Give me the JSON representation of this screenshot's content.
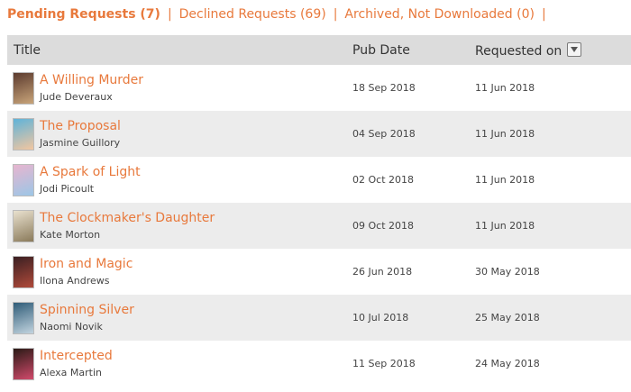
{
  "tabs": {
    "pending": "Pending Requests (7)",
    "declined": "Declined Requests (69)",
    "archived": "Archived, Not Downloaded (0)",
    "separator": "|"
  },
  "table": {
    "headers": {
      "title": "Title",
      "pub_date": "Pub Date",
      "requested_on": "Requested on"
    },
    "rows": [
      {
        "title": "A Willing Murder",
        "author": "Jude Deveraux",
        "pub_date": "18 Sep 2018",
        "requested_on": "11 Jun 2018",
        "cover_colors": [
          "#5b3a2e",
          "#c9a57a"
        ]
      },
      {
        "title": "The Proposal",
        "author": "Jasmine Guillory",
        "pub_date": "04 Sep 2018",
        "requested_on": "11 Jun 2018",
        "cover_colors": [
          "#5fb3d9",
          "#f2c6a0"
        ]
      },
      {
        "title": "A Spark of Light",
        "author": "Jodi Picoult",
        "pub_date": "02 Oct 2018",
        "requested_on": "11 Jun 2018",
        "cover_colors": [
          "#e7b5cf",
          "#9cc6e6"
        ]
      },
      {
        "title": "The Clockmaker's Daughter",
        "author": "Kate Morton",
        "pub_date": "09 Oct 2018",
        "requested_on": "11 Jun 2018",
        "cover_colors": [
          "#e9e1cf",
          "#8a7a5a"
        ]
      },
      {
        "title": "Iron and Magic",
        "author": "Ilona Andrews",
        "pub_date": "26 Jun 2018",
        "requested_on": "30 May 2018",
        "cover_colors": [
          "#3a1f22",
          "#b04a3a"
        ]
      },
      {
        "title": "Spinning Silver",
        "author": "Naomi Novik",
        "pub_date": "10 Jul 2018",
        "requested_on": "25 May 2018",
        "cover_colors": [
          "#2f5c78",
          "#c2d4df"
        ]
      },
      {
        "title": "Intercepted",
        "author": "Alexa Martin",
        "pub_date": "11 Sep 2018",
        "requested_on": "24 May 2018",
        "cover_colors": [
          "#2a1a16",
          "#d14a6b"
        ]
      }
    ]
  },
  "colors": {
    "accent": "#e8793c",
    "header_bg": "#dcdcdc",
    "row_alt_bg": "#ececec"
  },
  "icons": {
    "sort": "chevron-down-icon"
  }
}
